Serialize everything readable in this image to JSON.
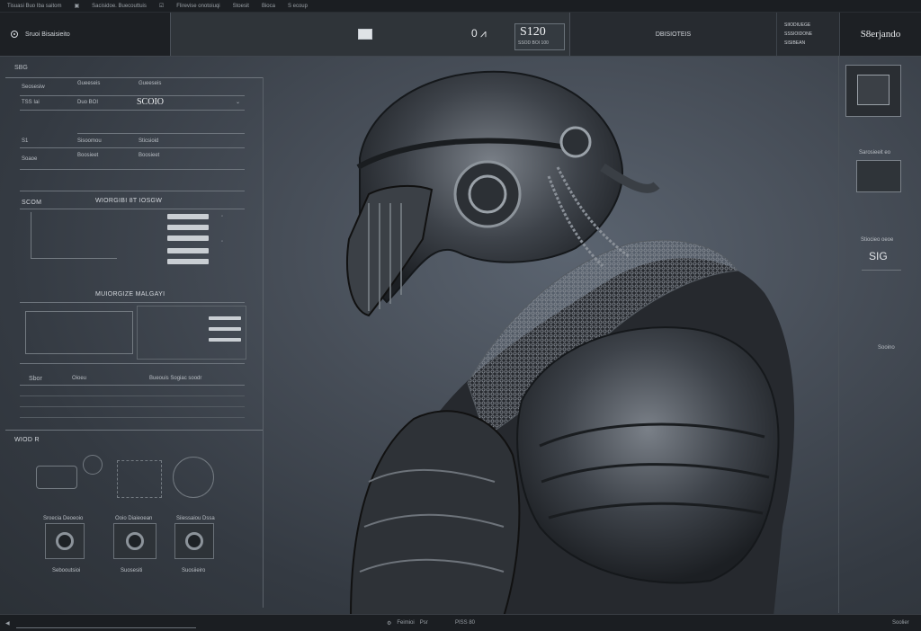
{
  "topstrip": [
    "Tisuasi Buo Iba saitom",
    "Sacisidoe. Buecouttuis",
    "Flirevise onotoiuqi",
    "Stoesit",
    "Bioca",
    "S ecoup"
  ],
  "toolbar": {
    "left_label": "Sruoi Bisaisieito",
    "readout_value": "S120",
    "readout_sub": "SSOD BOI 100",
    "right_label": "DBISIOTEIS",
    "right_small": [
      "SIIODIUEGE",
      "SSSIOIDONE",
      "SISIBEAN"
    ],
    "brand": "S8erjando"
  },
  "left_panel": {
    "header": "SBG",
    "rows1": [
      {
        "label": "Seosesiw",
        "value": "Gueeseis"
      },
      {
        "label": "TSS Iai",
        "value": "Duo BOI"
      },
      {
        "label": "",
        "value": "SCOIO"
      }
    ],
    "rows2": [
      {
        "label": "S1",
        "value": "Sisoomou"
      },
      {
        "label": "S1",
        "value": "Sticsioid"
      },
      {
        "label": "Soaoe",
        "value": "Boosieet"
      }
    ],
    "section_a": {
      "left": "SCOM",
      "title": "WIORGIBI 8T IOSGW"
    },
    "section_b": {
      "title": "MUIORGIZE MALGAYI"
    },
    "section_c": {
      "left": "Sbor",
      "title": "Bueouis Sogiac soodr",
      "mid": "Oioeu"
    },
    "section_d": {
      "title": "WIOD R"
    },
    "thumb_labels": [
      "Sroecia Deoeoio",
      "Ooio Diaieoean",
      "Siiessaiou Dssa"
    ],
    "thumb_caps": [
      "Sebooutsioi",
      "Suosesiti",
      "Suosiieiro"
    ]
  },
  "right_panel": {
    "captions": [
      "Sarosieeit eo",
      "Stiocieo oeoe",
      "Sooino"
    ],
    "labels": [
      "SIG"
    ]
  },
  "bottombar": {
    "left": "",
    "mid_value": "Feimioi",
    "mid_label": "Psr",
    "mid_right": "PISS 80",
    "right": "Soolier"
  },
  "colors": {
    "background": "#3a4048",
    "panel": "#24282d",
    "accent": "#e8eaed"
  }
}
